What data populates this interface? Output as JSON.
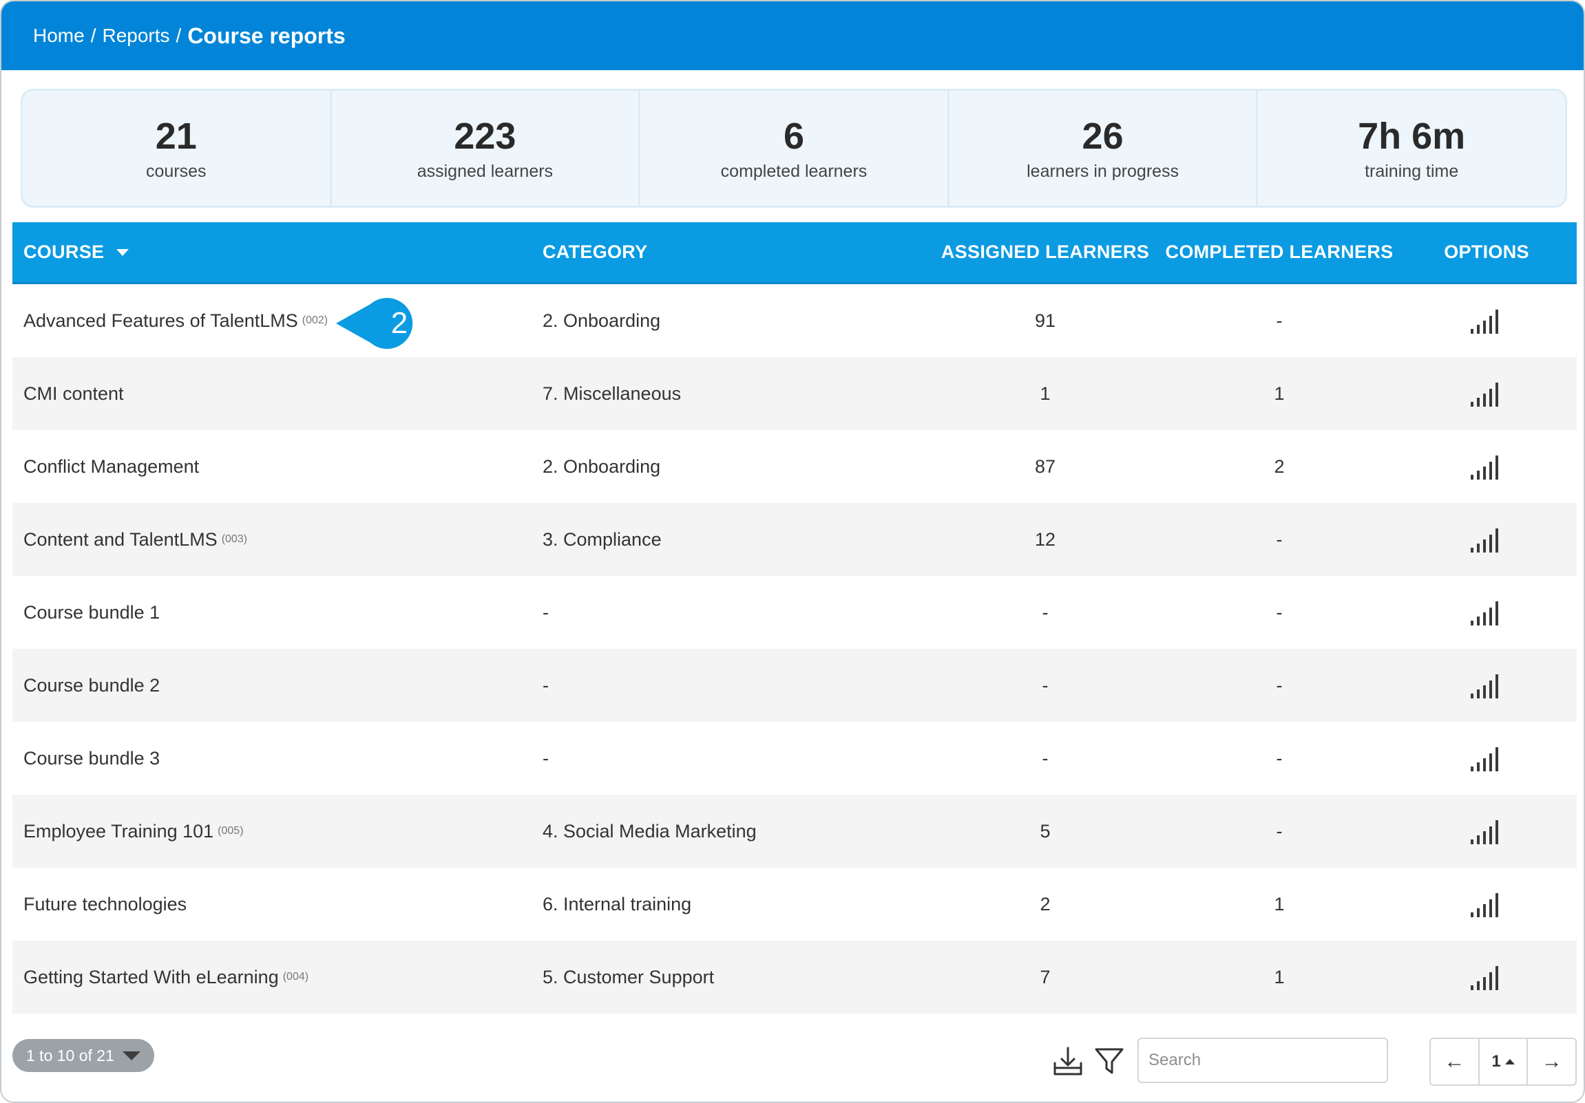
{
  "breadcrumb": {
    "home": "Home",
    "reports": "Reports",
    "current": "Course reports",
    "separator": "/"
  },
  "stats": [
    {
      "value": "21",
      "label": "courses"
    },
    {
      "value": "223",
      "label": "assigned learners"
    },
    {
      "value": "6",
      "label": "completed learners"
    },
    {
      "value": "26",
      "label": "learners in progress"
    },
    {
      "value": "7h 6m",
      "label": "training time"
    }
  ],
  "table": {
    "headers": {
      "course": "COURSE",
      "category": "CATEGORY",
      "assigned": "ASSIGNED LEARNERS",
      "completed": "COMPLETED LEARNERS",
      "options": "OPTIONS"
    },
    "rows": [
      {
        "course": "Advanced Features of TalentLMS",
        "code": "(002)",
        "category": "2. Onboarding",
        "assigned": "91",
        "completed": "-"
      },
      {
        "course": "CMI content",
        "code": "",
        "category": "7. Miscellaneous",
        "assigned": "1",
        "completed": "1"
      },
      {
        "course": "Conflict Management",
        "code": "",
        "category": "2. Onboarding",
        "assigned": "87",
        "completed": "2"
      },
      {
        "course": "Content and TalentLMS",
        "code": "(003)",
        "category": "3. Compliance",
        "assigned": "12",
        "completed": "-"
      },
      {
        "course": "Course bundle 1",
        "code": "",
        "category": "-",
        "assigned": "-",
        "completed": "-"
      },
      {
        "course": "Course bundle 2",
        "code": "",
        "category": "-",
        "assigned": "-",
        "completed": "-"
      },
      {
        "course": "Course bundle 3",
        "code": "",
        "category": "-",
        "assigned": "-",
        "completed": "-"
      },
      {
        "course": "Employee Training 101",
        "code": "(005)",
        "category": "4. Social Media Marketing",
        "assigned": "5",
        "completed": "-"
      },
      {
        "course": "Future technologies",
        "code": "",
        "category": "6. Internal training",
        "assigned": "2",
        "completed": "1"
      },
      {
        "course": "Getting Started With eLearning",
        "code": "(004)",
        "category": "5. Customer Support",
        "assigned": "7",
        "completed": "1"
      }
    ]
  },
  "callout": {
    "label": "2",
    "color": "#0a9be3"
  },
  "footer": {
    "count_label": "1 to 10 of 21",
    "search_placeholder": "Search",
    "prev": "←",
    "page": "1",
    "next": "→",
    "icons": [
      "download-icon",
      "filter-icon"
    ]
  },
  "colors": {
    "topbar": "#0285d8",
    "table_header": "#0a9be3",
    "stats_bg": "#eef6fc"
  }
}
